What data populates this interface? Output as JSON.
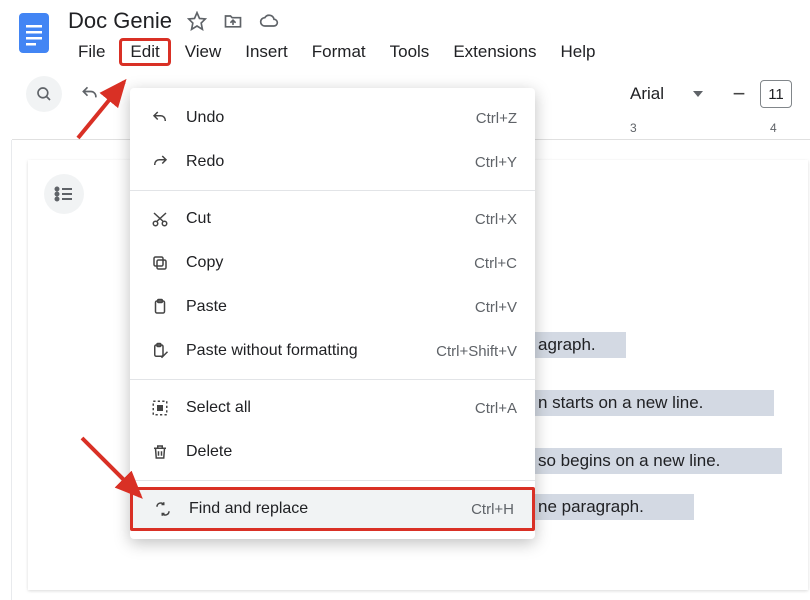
{
  "doc": {
    "title": "Doc Genie"
  },
  "menubar": [
    "File",
    "Edit",
    "View",
    "Insert",
    "Format",
    "Tools",
    "Extensions",
    "Help"
  ],
  "active_menu_index": 1,
  "toolbar": {
    "font": "Arial",
    "size": "11",
    "ruler_labels": {
      "n3": "3",
      "n4": "4"
    }
  },
  "edit_menu": {
    "groups": [
      [
        {
          "icon": "undo",
          "label": "Undo",
          "shortcut": "Ctrl+Z"
        },
        {
          "icon": "redo",
          "label": "Redo",
          "shortcut": "Ctrl+Y"
        }
      ],
      [
        {
          "icon": "cut",
          "label": "Cut",
          "shortcut": "Ctrl+X"
        },
        {
          "icon": "copy",
          "label": "Copy",
          "shortcut": "Ctrl+C"
        },
        {
          "icon": "paste",
          "label": "Paste",
          "shortcut": "Ctrl+V"
        },
        {
          "icon": "paste-nf",
          "label": "Paste without formatting",
          "shortcut": "Ctrl+Shift+V"
        }
      ],
      [
        {
          "icon": "select-all",
          "label": "Select all",
          "shortcut": "Ctrl+A"
        },
        {
          "icon": "delete",
          "label": "Delete",
          "shortcut": ""
        }
      ],
      [
        {
          "icon": "find",
          "label": "Find and replace",
          "shortcut": "Ctrl+H",
          "highlight": true,
          "hover": true
        }
      ]
    ]
  },
  "page_text": {
    "frag1": "agraph.",
    "frag2": "n starts on a new line.",
    "frag3": "so begins on a new line.",
    "frag4": "ne paragraph."
  }
}
